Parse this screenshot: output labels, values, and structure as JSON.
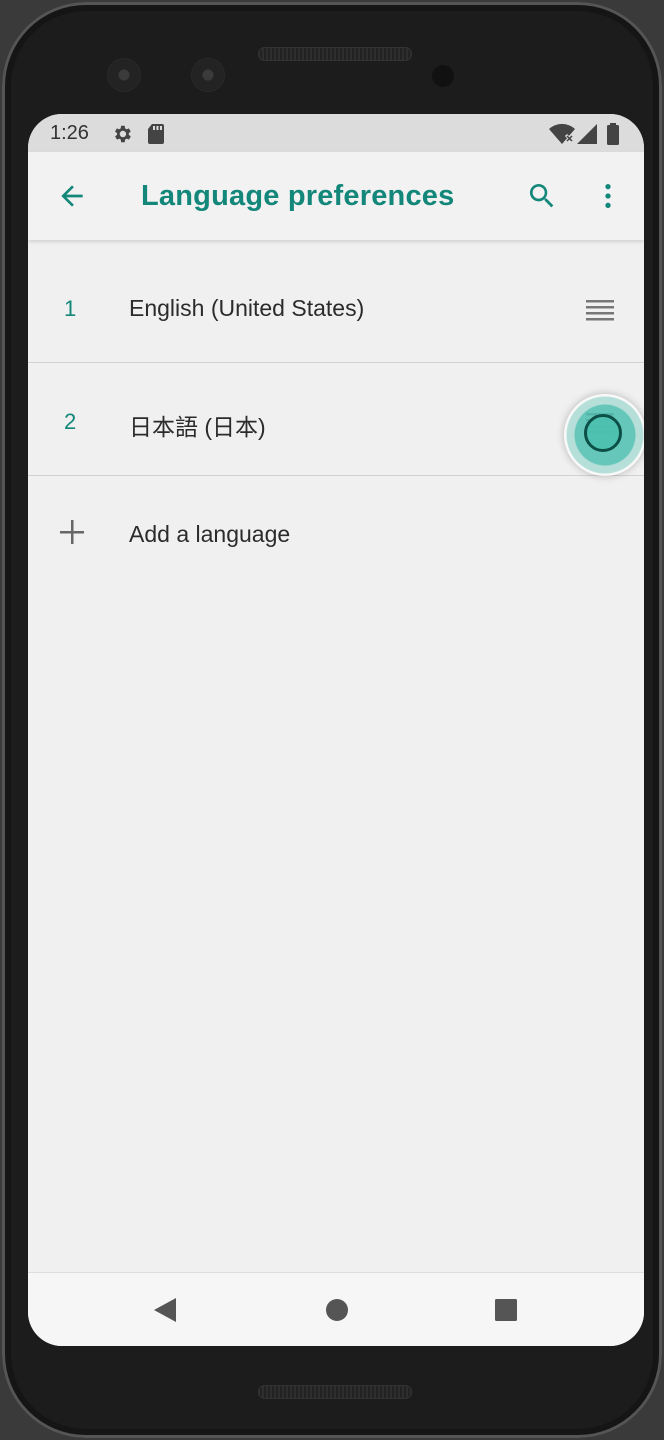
{
  "status_bar": {
    "time": "1:26",
    "icons": [
      "settings-gear-icon",
      "sd-card-icon",
      "wifi-off-icon",
      "cellular-signal-icon",
      "battery-icon"
    ]
  },
  "app_bar": {
    "title": "Language preferences",
    "back_icon": "arrow-left-icon",
    "search_icon": "search-icon",
    "menu_icon": "more-vert-icon",
    "accent_color": "#13877a"
  },
  "languages": [
    {
      "index": "1",
      "label": "English (United States)"
    },
    {
      "index": "2",
      "label": "日本語 (日本)"
    }
  ],
  "add_language": {
    "label": "Add a language",
    "icon": "plus-icon"
  },
  "nav_bar": {
    "buttons": [
      "back-triangle-icon",
      "home-circle-icon",
      "recents-square-icon"
    ]
  }
}
